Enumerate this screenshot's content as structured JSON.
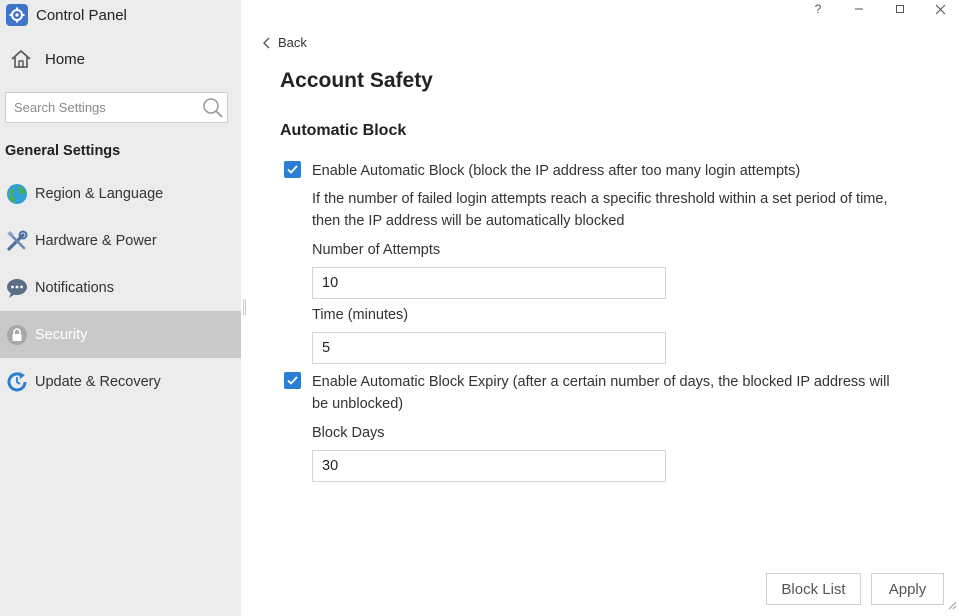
{
  "app": {
    "title": "Control Panel"
  },
  "sidebar": {
    "home_label": "Home",
    "search_placeholder": "Search Settings",
    "section_label": "General Settings",
    "items": [
      {
        "label": "Region & Language",
        "icon": "globe-icon"
      },
      {
        "label": "Hardware & Power",
        "icon": "tools-icon"
      },
      {
        "label": "Notifications",
        "icon": "chat-bubble-icon"
      },
      {
        "label": "Security",
        "icon": "lock-icon",
        "active": true
      },
      {
        "label": "Update & Recovery",
        "icon": "update-icon"
      }
    ]
  },
  "window_controls": {
    "help": "?",
    "minimize": "–",
    "maximize": "□",
    "close": "✕"
  },
  "main": {
    "back_label": "Back",
    "page_title": "Account Safety",
    "section_title": "Automatic Block",
    "auto_block": {
      "checked": true,
      "label": "Enable Automatic Block (block the IP address after too many login attempts)",
      "description": "If the number of failed login attempts reach a specific threshold within a set period of time, then the IP address will be automatically blocked",
      "attempts_label": "Number of Attempts",
      "attempts_value": "10",
      "time_label": "Time (minutes)",
      "time_value": "5"
    },
    "expiry": {
      "checked": true,
      "label": "Enable Automatic Block Expiry (after a certain number of days, the blocked IP address will be unblocked)",
      "days_label": "Block Days",
      "days_value": "30"
    }
  },
  "footer": {
    "block_list_label": "Block List",
    "apply_label": "Apply"
  },
  "colors": {
    "accent": "#2a7fd4",
    "sidebar_bg": "#ececec",
    "active_item_bg": "#c9c9c9"
  }
}
